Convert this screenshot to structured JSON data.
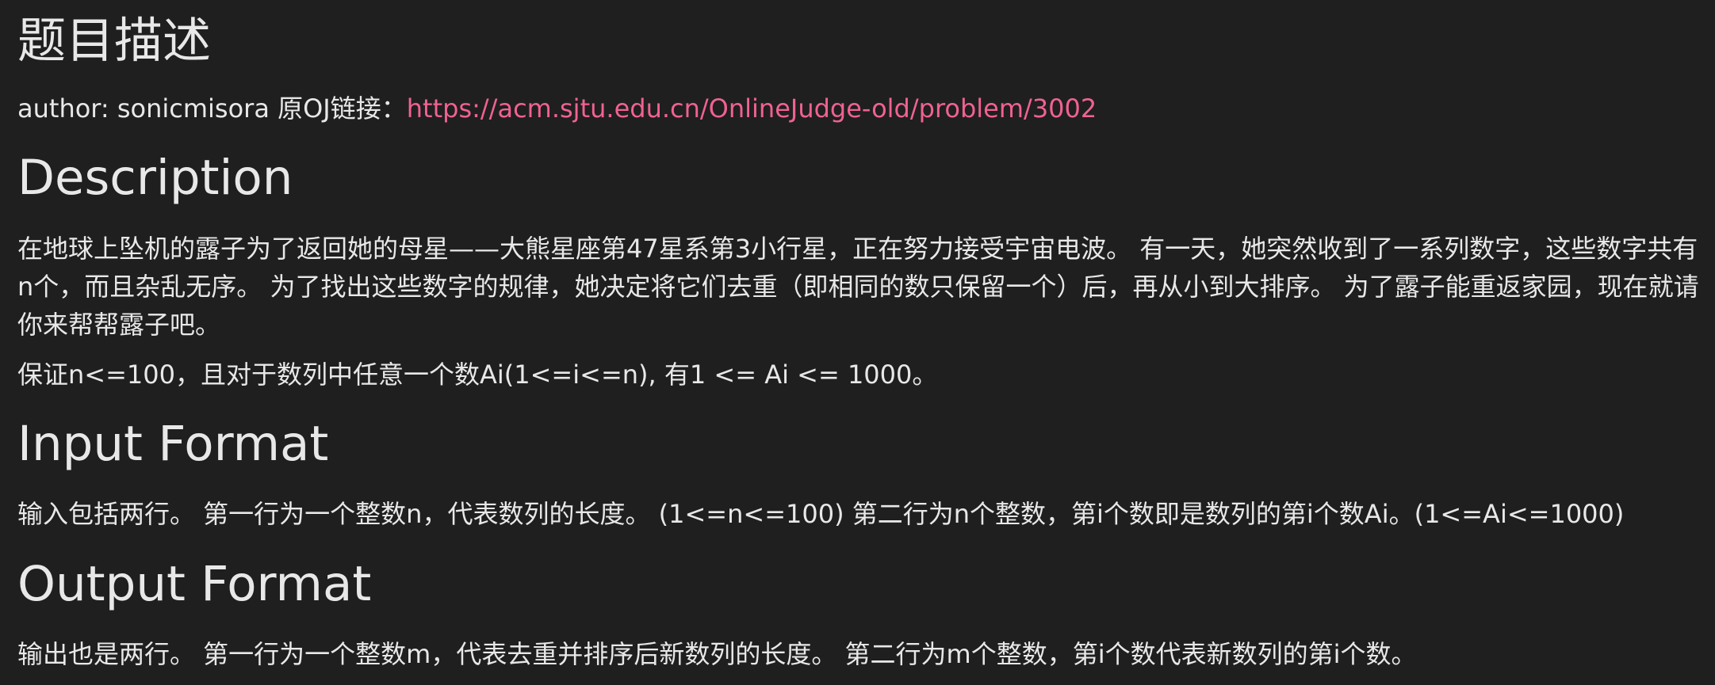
{
  "title": "题目描述",
  "author_line": {
    "author_label": "author: sonicmisora 原OJ链接：",
    "link_text": "https://acm.sjtu.edu.cn/OnlineJudge-old/problem/3002"
  },
  "description": {
    "heading": "Description",
    "para1": "在地球上坠机的露子为了返回她的母星——大熊星座第47星系第3小行星，正在努力接受宇宙电波。 有一天，她突然收到了一系列数字，这些数字共有n个，而且杂乱无序。 为了找出这些数字的规律，她决定将它们去重（即相同的数只保留一个）后，再从小到大排序。 为了露子能重返家园，现在就请你来帮帮露子吧。",
    "para2": "保证n<=100，且对于数列中任意一个数Ai(1<=i<=n), 有1 <= Ai <= 1000。"
  },
  "input_format": {
    "heading": "Input Format",
    "text": "输入包括两行。 第一行为一个整数n，代表数列的长度。 (1<=n<=100) 第二行为n个整数，第i个数即是数列的第i个数Ai。(1<=Ai<=1000)"
  },
  "output_format": {
    "heading": "Output Format",
    "text": "输出也是两行。 第一行为一个整数m，代表去重并排序后新数列的长度。 第二行为m个整数，第i个数代表新数列的第i个数。"
  },
  "colors": {
    "background": "#1f1f1f",
    "text": "#e8e8e8",
    "link": "#f06292"
  }
}
